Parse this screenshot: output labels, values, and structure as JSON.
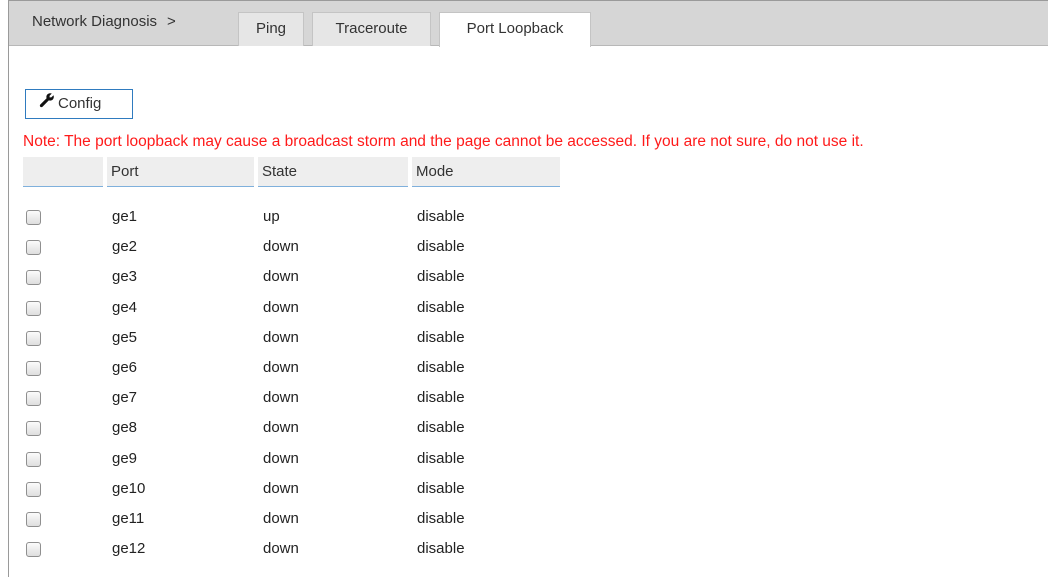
{
  "breadcrumb": {
    "label": "Network Diagnosis",
    "separator": ">"
  },
  "tabs": [
    {
      "label": "Ping",
      "active": false
    },
    {
      "label": "Traceroute",
      "active": false
    },
    {
      "label": "Port Loopback",
      "active": true
    }
  ],
  "toolbar": {
    "config_label": "Config",
    "config_icon": "wrench-icon"
  },
  "note": "Note: The port loopback may cause a broadcast storm and the page cannot be accessed. If you are not sure, do not use it.",
  "table": {
    "columns": [
      "Port",
      "State",
      "Mode"
    ],
    "rows": [
      {
        "port": "ge1",
        "state": "up",
        "mode": "disable",
        "checked": false
      },
      {
        "port": "ge2",
        "state": "down",
        "mode": "disable",
        "checked": false
      },
      {
        "port": "ge3",
        "state": "down",
        "mode": "disable",
        "checked": false
      },
      {
        "port": "ge4",
        "state": "down",
        "mode": "disable",
        "checked": false
      },
      {
        "port": "ge5",
        "state": "down",
        "mode": "disable",
        "checked": false
      },
      {
        "port": "ge6",
        "state": "down",
        "mode": "disable",
        "checked": false
      },
      {
        "port": "ge7",
        "state": "down",
        "mode": "disable",
        "checked": false
      },
      {
        "port": "ge8",
        "state": "down",
        "mode": "disable",
        "checked": false
      },
      {
        "port": "ge9",
        "state": "down",
        "mode": "disable",
        "checked": false
      },
      {
        "port": "ge10",
        "state": "down",
        "mode": "disable",
        "checked": false
      },
      {
        "port": "ge11",
        "state": "down",
        "mode": "disable",
        "checked": false
      },
      {
        "port": "ge12",
        "state": "down",
        "mode": "disable",
        "checked": false
      }
    ]
  },
  "colors": {
    "note_text": "#ff1a1a",
    "button_border": "#2f7bbf",
    "header_underline": "#7fb0dc",
    "tabbar_background": "#d6d6d6"
  }
}
